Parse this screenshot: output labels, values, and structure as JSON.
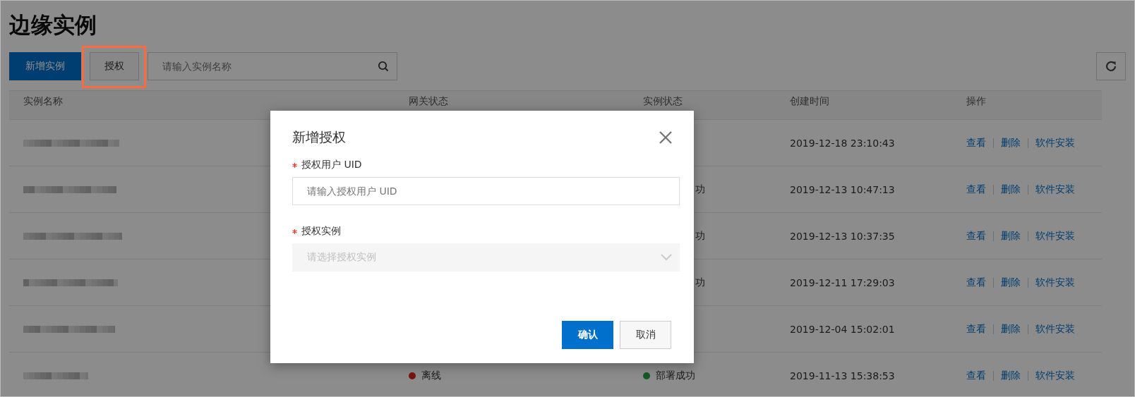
{
  "page_title": "边缘实例",
  "toolbar": {
    "add_button": "新增实例",
    "auth_button": "授权",
    "auth_highlighted": true,
    "search": {
      "placeholder": "请输入实例名称"
    }
  },
  "table": {
    "columns": [
      "实例名称",
      "网关状态",
      "实例状态",
      "创建时间",
      "操作"
    ],
    "rows": [
      {
        "created": "2019-12-18 23:10:43",
        "actions": [
          "查看",
          "删除",
          "软件安装"
        ]
      },
      {
        "instance_status": {
          "text": "功",
          "clipped_left": true
        },
        "created": "2019-12-13 10:47:13",
        "actions": [
          "查看",
          "删除",
          "软件安装"
        ]
      },
      {
        "instance_status": {
          "text": "功",
          "clipped_left": true
        },
        "created": "2019-12-13 10:37:35",
        "actions": [
          "查看",
          "删除",
          "软件安装"
        ]
      },
      {
        "instance_status": {
          "text": "功",
          "clipped_left": true
        },
        "created": "2019-12-11 17:29:03",
        "actions": [
          "查看",
          "删除",
          "软件安装"
        ]
      },
      {
        "created": "2019-12-04 15:02:01",
        "actions": [
          "查看",
          "删除",
          "软件安装"
        ]
      },
      {
        "gateway_status": {
          "text": "离线",
          "color": "#7a1410"
        },
        "instance_status": {
          "text": "部署成功",
          "color": "#145a24",
          "clipped_left": false
        },
        "created": "2019-11-13 15:38:53",
        "actions": [
          "查看",
          "删除",
          "软件安装"
        ]
      }
    ]
  },
  "dialog": {
    "title": "新增授权",
    "fields": [
      {
        "kind": "input",
        "label": "授权用户 UID",
        "required": true,
        "placeholder": "请输入授权用户 UID",
        "disabled": false
      },
      {
        "kind": "select",
        "label": "授权实例",
        "required": true,
        "placeholder": "请选择授权实例",
        "disabled": true
      }
    ],
    "buttons": [
      {
        "label": "确认",
        "primary": true
      },
      {
        "label": "取消",
        "primary": false
      }
    ]
  }
}
